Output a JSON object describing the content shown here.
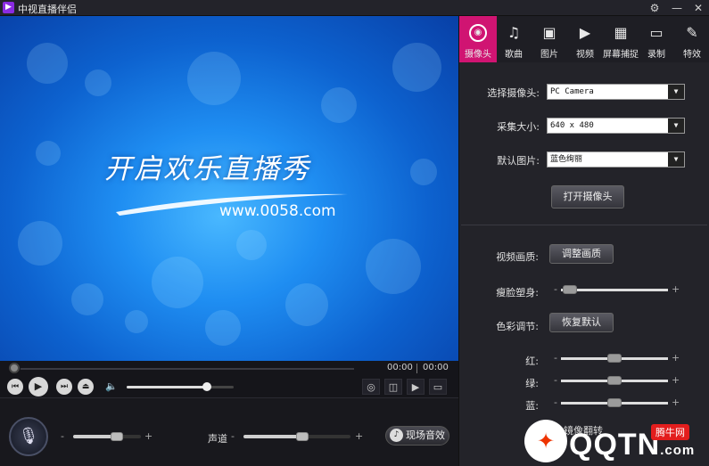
{
  "window": {
    "title": "中视直播伴侣",
    "icon_glyph": "▶",
    "settings_icon": "⚙",
    "minimize_icon": "—",
    "close_icon": "✕"
  },
  "video": {
    "headline": "开启欢乐直播秀",
    "url": "www.0058.com"
  },
  "playback": {
    "current_time": "00:00",
    "total_time": "00:00",
    "volume_level": 0.75
  },
  "bottom": {
    "mic_volume_level": 0.65,
    "channel_label": "声道",
    "channel_level": 0.55,
    "effect_button": "现场音效",
    "minus": "-",
    "plus": "+"
  },
  "tabs": [
    {
      "label": "摄像头",
      "icon": "camera-icon",
      "glyph": "◉",
      "active": true
    },
    {
      "label": "歌曲",
      "icon": "music-icon",
      "glyph": "♫",
      "active": false
    },
    {
      "label": "图片",
      "icon": "image-icon",
      "glyph": "▣",
      "active": false
    },
    {
      "label": "视频",
      "icon": "video-camera-icon",
      "glyph": "▶",
      "active": false
    },
    {
      "label": "屏幕捕捉",
      "icon": "film-icon",
      "glyph": "▦",
      "active": false
    },
    {
      "label": "录制",
      "icon": "record-icon",
      "glyph": "▭",
      "active": false
    },
    {
      "label": "特效",
      "icon": "magic-wand-icon",
      "glyph": "✎",
      "active": false
    }
  ],
  "camera": {
    "select_label": "选择摄像头:",
    "select_value": "PC Camera",
    "size_label": "采集大小:",
    "size_value": "640 x 480",
    "default_pic_label": "默认图片:",
    "default_pic_value": "蓝色绚丽",
    "open_button": "打开摄像头"
  },
  "adjust": {
    "quality_label": "视频画质:",
    "quality_button": "调整画质",
    "slim_label": "瘦脸塑身:",
    "slim_level": 0.08,
    "color_label": "色彩调节:",
    "reset_button": "恢复默认",
    "red_label": "红:",
    "red_level": 0.5,
    "green_label": "绿:",
    "green_level": 0.5,
    "blue_label": "蓝:",
    "blue_level": 0.5,
    "mirror_label": "镜像翻转"
  },
  "watermark": {
    "brand": "QQTN",
    "suffix": ".com",
    "badge": "腾牛网"
  }
}
